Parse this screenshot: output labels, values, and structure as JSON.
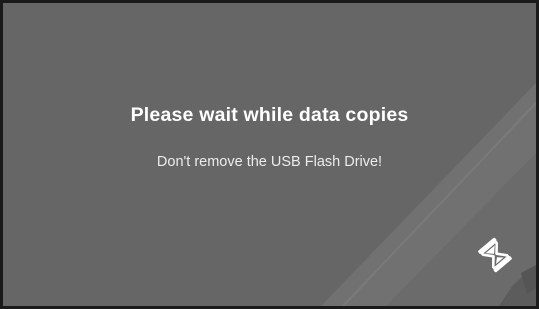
{
  "dialog": {
    "title": "Please wait while data copies",
    "message": "Don't remove the USB Flash Drive!"
  },
  "icons": {
    "busy": "hourglass-icon"
  },
  "colors": {
    "background": "#666666",
    "decor_band": "#6f6f6f",
    "decor_dark": "#5a5a5a",
    "text": "#ffffff",
    "frame": "#1a1a1a"
  }
}
